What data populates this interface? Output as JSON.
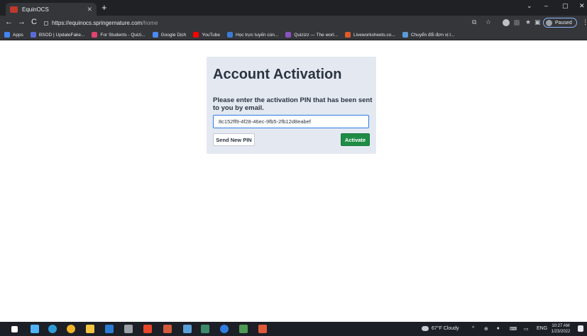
{
  "browser": {
    "tab_title": "EquinOCS",
    "tab_close": "✕",
    "new_tab": "+",
    "window_controls": [
      "⌄",
      "–",
      "▢",
      "✕"
    ],
    "url_host": "https://equinocs.springernature.com",
    "url_path": "/home",
    "nav": {
      "back": "←",
      "forward": "→",
      "reload": "C"
    },
    "toolbar_icons": {
      "share": "⧉",
      "star": "☆",
      "extensions": "★",
      "sidebar": "▣"
    },
    "profile_label": "Paused",
    "menu": "⋮"
  },
  "bookmarks": [
    {
      "label": "Apps",
      "color": "#4285f4"
    },
    {
      "label": "BSOD | UpdateFake...",
      "color": "#5b6bd6"
    },
    {
      "label": "For Students - Quizi...",
      "color": "#e0446d"
    },
    {
      "label": "Google Dịch",
      "color": "#4a8af4"
    },
    {
      "label": "YouTube",
      "color": "#ff0000"
    },
    {
      "label": "Học trực tuyến cùn...",
      "color": "#3a7bd5"
    },
    {
      "label": "Quizizz — The worl...",
      "color": "#8854c0"
    },
    {
      "label": "Liveworksheets.co...",
      "color": "#e05a2a"
    },
    {
      "label": "Chuyển đổi đơn vị l...",
      "color": "#5b9bd5"
    }
  ],
  "page": {
    "title": "Account Activation",
    "prompt": "Please enter the activation PIN that has been sent to you by email.",
    "pin_value": "8c152ff9-4f28-46ec-9fb5-2fb12d8eabef",
    "send_label": "Send New PIN",
    "activate_label": "Activate"
  },
  "taskbar": {
    "weather": "67°F Cloudy",
    "language": "ENG",
    "time": "10:27 AM",
    "date": "1/23/2022"
  }
}
